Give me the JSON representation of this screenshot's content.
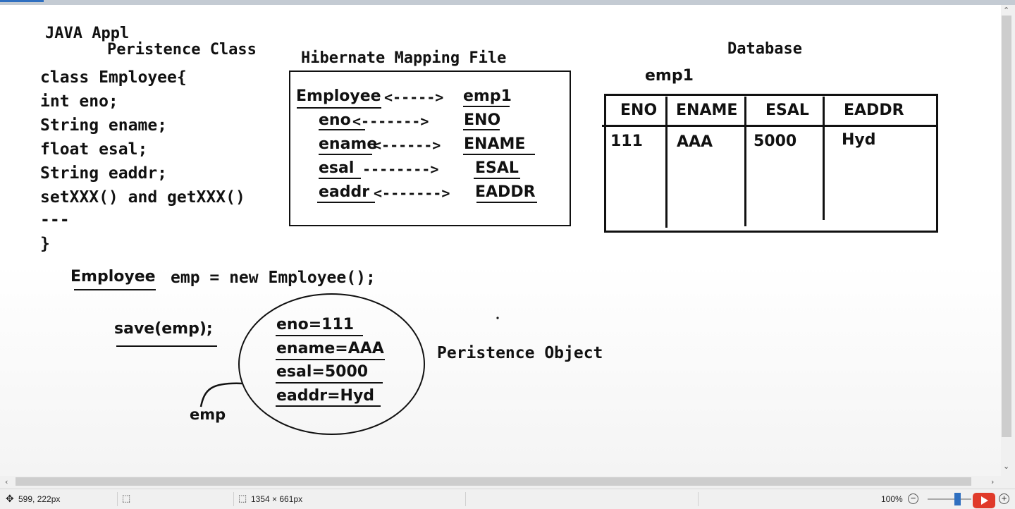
{
  "diagram": {
    "java_appl_label": "JAVA Appl",
    "persistence_class_label": "Peristence Class",
    "class_lines": [
      "class Employee{",
      "int eno;",
      "String ename;",
      "float esal;",
      "String eaddr;",
      "setXXX() and getXXX()",
      "---",
      "}"
    ],
    "mapping_title": "Hibernate Mapping File",
    "mapping": {
      "class_name": "Employee",
      "class_arrow": "<----->",
      "table_name": "emp1",
      "rows": [
        {
          "field": "eno",
          "arrow": "<------->",
          "column": "ENO"
        },
        {
          "field": "ename",
          "arrow": "<------>",
          "column": "ENAME"
        },
        {
          "field": "esal",
          "arrow": "-------->",
          "column": "ESAL"
        },
        {
          "field": "eaddr",
          "arrow": "<------->",
          "column": "EADDR"
        }
      ]
    },
    "database_title": "Database",
    "table_caption": "emp1",
    "table_headers": [
      "ENO",
      "ENAME",
      "ESAL",
      "EADDR"
    ],
    "table_rows": [
      [
        "111",
        "AAA",
        "5000",
        "Hyd"
      ]
    ],
    "new_employee_stmt": {
      "type": "Employee",
      "rest": "emp = new Employee();"
    },
    "save_stmt": "save(emp);",
    "object_fields": [
      "eno=111",
      "ename=AAA",
      "esal=5000",
      "eaddr=Hyd"
    ],
    "object_ref_label": "emp",
    "persistence_object_label": "Peristence Object"
  },
  "statusbar": {
    "cursor_position": "599, 222px",
    "image_size": "1354 × 661px",
    "zoom": "100%"
  }
}
